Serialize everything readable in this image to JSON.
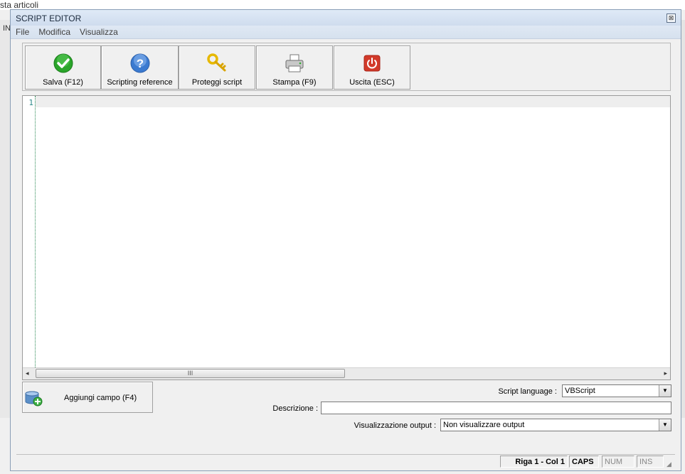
{
  "background": {
    "window_title": "sta articoli",
    "panel_text": "IN"
  },
  "dialog": {
    "title": "SCRIPT EDITOR",
    "close_glyph": "⊠"
  },
  "menu": [
    "File",
    "Modifica",
    "Visualizza"
  ],
  "toolbar": {
    "buttons": [
      {
        "label": "Salva (F12)",
        "icon": "check-icon"
      },
      {
        "label": "Scripting reference",
        "icon": "help-icon"
      },
      {
        "label": "Proteggi script",
        "icon": "key-icon"
      },
      {
        "label": "Stampa (F9)",
        "icon": "printer-icon"
      },
      {
        "label": "Uscita (ESC)",
        "icon": "power-icon"
      }
    ]
  },
  "editor": {
    "line_numbers": [
      "1"
    ],
    "content": "",
    "scroll_thumb_glyph": "III",
    "scroll_left": "◂",
    "scroll_right": "▸"
  },
  "add_field": {
    "label": "Aggiungi campo (F4)",
    "icon": "add-database-icon"
  },
  "form": {
    "script_language_label": "Script language :",
    "script_language_value": "VBScript",
    "descrizione_label": "Descrizione :",
    "descrizione_value": "",
    "output_label": "Visualizzazione output :",
    "output_value": "Non visualizzare output",
    "dropdown_glyph": "▼"
  },
  "status": {
    "position": "Riga 1 - Col 1",
    "caps": "CAPS",
    "num": "NUM",
    "ins": "INS"
  },
  "colors": {
    "title_bar": "#dfeaf7",
    "accent_green": "#2aa52a",
    "accent_blue": "#3b7ad0",
    "accent_red": "#d23a2a",
    "key_yellow": "#e6b800"
  }
}
